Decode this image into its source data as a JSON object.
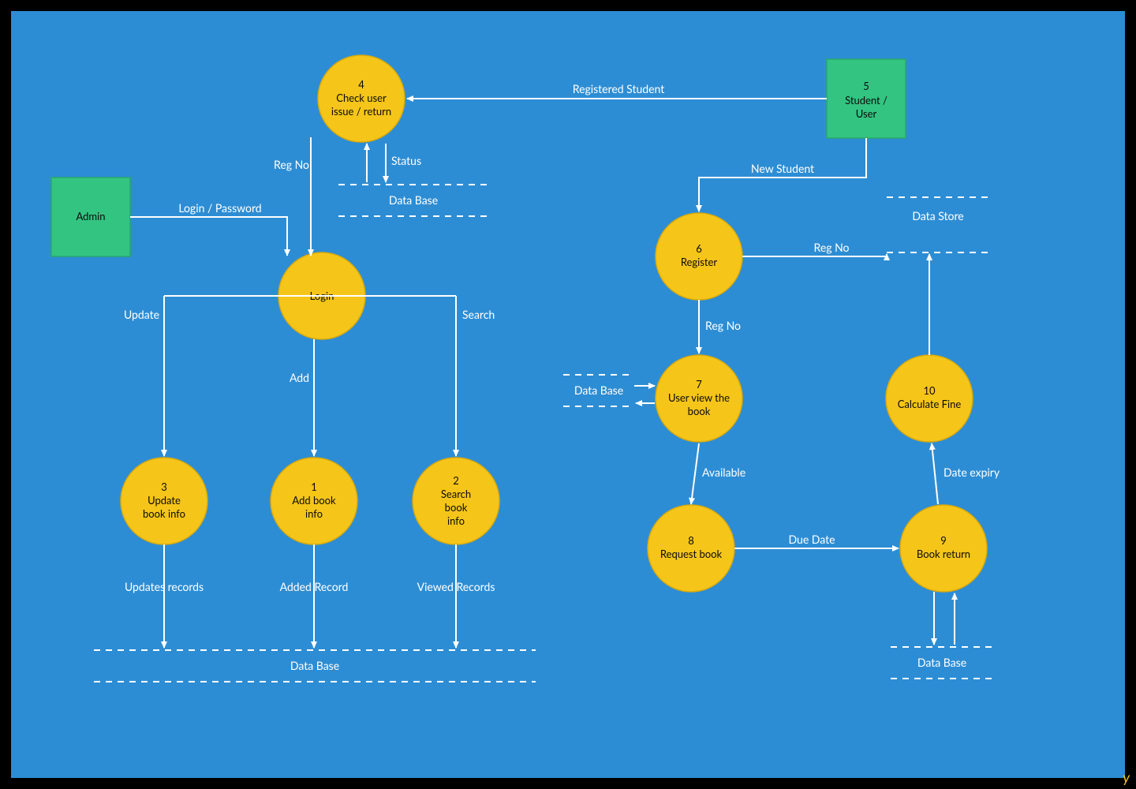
{
  "entities": {
    "admin": {
      "label": "Admin"
    },
    "studentUser": {
      "num": "5",
      "l1": "Student /",
      "l2": "User"
    }
  },
  "processes": {
    "login": {
      "label": "Login"
    },
    "addBook": {
      "num": "1",
      "l1": "Add book",
      "l2": "info"
    },
    "searchBook": {
      "num": "2",
      "l1": "Search",
      "l2": "book",
      "l3": "info"
    },
    "updateBook": {
      "num": "3",
      "l1": "Update",
      "l2": "book info"
    },
    "checkUser": {
      "num": "4",
      "l1": "Check user",
      "l2": "issue / return"
    },
    "register": {
      "num": "6",
      "l1": "Register"
    },
    "viewBook": {
      "num": "7",
      "l1": "User view the",
      "l2": "book"
    },
    "requestBook": {
      "num": "8",
      "l1": "Request book"
    },
    "bookReturn": {
      "num": "9",
      "l1": "Book return"
    },
    "calcFine": {
      "num": "10",
      "l1": "Calculate Fine"
    }
  },
  "stores": {
    "db_check": "Data Base",
    "db_books": "Data Base",
    "db_view": "Data Base",
    "ds_reg": "Data Store",
    "db_return": "Data Base"
  },
  "flows": {
    "loginPassword": "Login / Password",
    "regNo1": "Reg No",
    "status": "Status",
    "registeredStudent": "Registered Student",
    "newStudent": "New Student",
    "regNo2": "Reg No",
    "regNo3": "Reg No",
    "available": "Available",
    "dueDate": "Due Date",
    "dateExpiry": "Date expiry",
    "update": "Update",
    "add": "Add",
    "search": "Search",
    "updatesRecords": "Updates records",
    "addedRecord": "Added Record",
    "viewedRecords": "Viewed Records"
  },
  "tag": "y"
}
